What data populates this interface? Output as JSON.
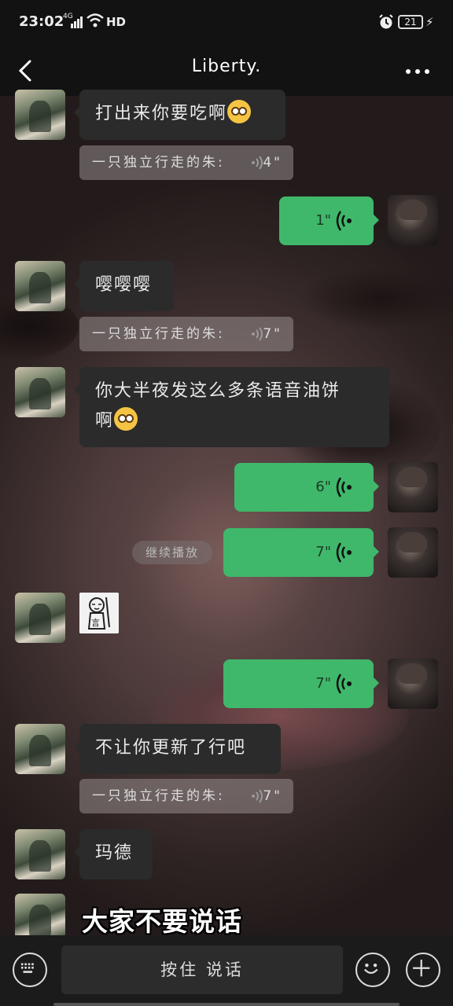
{
  "status_bar": {
    "time": "23:02",
    "network": "4G",
    "hd": "HD",
    "battery": "21"
  },
  "header": {
    "title": "Liberty.",
    "back_icon": "chevron-left-icon",
    "more_icon": "more-dots-icon"
  },
  "messages": [
    {
      "from": "friend",
      "text": "打出来你要吃啊"
    },
    {
      "from": "friend",
      "type": "quote",
      "text": "一只独立行走的朱:",
      "duration": "4\""
    },
    {
      "from": "me",
      "type": "voice",
      "duration": "1\""
    },
    {
      "from": "friend",
      "text": "嘤嘤嘤"
    },
    {
      "from": "friend",
      "type": "quote",
      "text": "一只独立行走的朱:",
      "duration": "7\""
    },
    {
      "from": "friend",
      "text_line1": "你大半夜发这么多条语音油饼",
      "text_line2": "啊"
    },
    {
      "from": "me",
      "type": "voice",
      "duration": "6\""
    },
    {
      "from": "me",
      "type": "voice",
      "duration": "7\""
    },
    {
      "from": "friend",
      "type": "sticker"
    },
    {
      "from": "me",
      "type": "voice",
      "duration": "7\""
    },
    {
      "from": "friend",
      "text": "不让你更新了行吧"
    },
    {
      "from": "friend",
      "type": "quote",
      "text": "一只独立行走的朱:",
      "duration": "7\""
    },
    {
      "from": "friend",
      "text": "玛德"
    }
  ],
  "continue_play": "继续播放",
  "caption": "大家不要说话",
  "input_bar": {
    "hold_to_talk": "按住 说话"
  },
  "colors": {
    "voice_bubble": "#3fb86b",
    "friend_bubble": "#2b2b2b",
    "bar_bg": "#121212"
  }
}
